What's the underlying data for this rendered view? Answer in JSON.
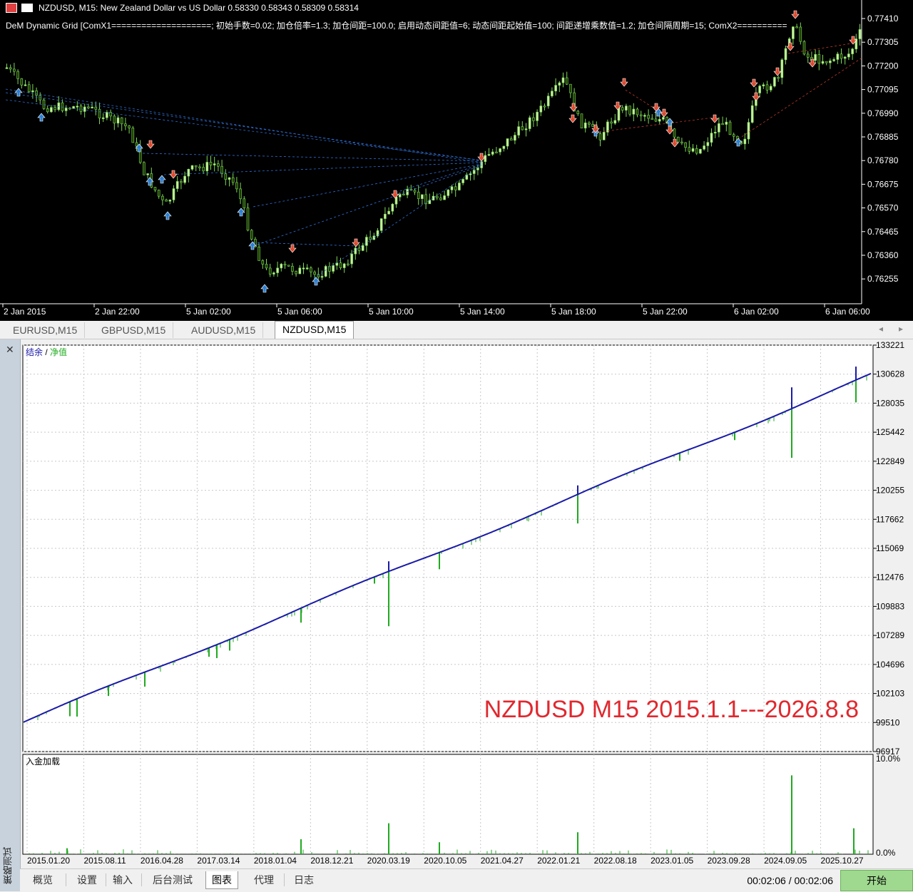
{
  "price_chart": {
    "symbol_line": "NZDUSD, M15:  New Zealand Dollar vs US Dollar  0.58330 0.58343 0.58309 0.58314",
    "indicator_line": "DeM Dynamic Grid [ComX1====================; 初始手数=0.02; 加仓倍率=1.3; 加仓间距=100.0; 启用动态间距值=6; 动态间距起始值=100; 间距递增乘数值=1.2; 加仓间隔周期=15; ComX2==========",
    "price_labels": [
      "0.77410",
      "0.77305",
      "0.77200",
      "0.77095",
      "0.76990",
      "0.76885",
      "0.76780",
      "0.76675",
      "0.76570",
      "0.76465",
      "0.76360",
      "0.76255"
    ],
    "time_labels": [
      "2 Jan 2015",
      "2 Jan 22:00",
      "5 Jan 02:00",
      "5 Jan 06:00",
      "5 Jan 10:00",
      "5 Jan 14:00",
      "5 Jan 18:00",
      "5 Jan 22:00",
      "6 Jan 02:00",
      "6 Jan 06:00"
    ],
    "colors": {
      "background": "#000000",
      "bull": "#c8f0a0",
      "bear": "#1a3a00",
      "wick": "#7ed957",
      "buy_arrow": "#2a7fd4",
      "sell_arrow": "#e0482c"
    }
  },
  "chart_tabs": {
    "items": [
      "EURUSD,M15",
      "GBPUSD,M15",
      "AUDUSD,M15",
      "NZDUSD,M15"
    ],
    "active": "NZDUSD,M15"
  },
  "tester": {
    "close_label": "✕",
    "side_label": "策略测试",
    "legend_balance": "结余",
    "legend_sep": " / ",
    "legend_equity": "净值",
    "watermark": "NZDUSD M15 2015.1.1---2026.8.8",
    "deposit_label": "入金加载",
    "deposit_max": "10.0%",
    "deposit_min": "0.0%",
    "y_labels": [
      "133221",
      "130628",
      "128035",
      "125442",
      "122849",
      "120255",
      "117662",
      "115069",
      "112476",
      "109883",
      "107289",
      "104696",
      "102103",
      "99510",
      "96917"
    ],
    "x_labels": [
      "2015.01.20",
      "2015.08.11",
      "2016.04.28",
      "2017.03.14",
      "2018.01.04",
      "2018.12.21",
      "2020.03.19",
      "2020.10.05",
      "2021.04.27",
      "2022.01.21",
      "2022.08.18",
      "2023.01.05",
      "2023.09.28",
      "2024.09.05",
      "2025.10.27"
    ],
    "colors": {
      "balance": "#1a1aa8",
      "equity": "#1faa1f",
      "watermark": "#e0282e",
      "grid": "#c8c8c8"
    }
  },
  "chart_data": {
    "type": "line",
    "title": "",
    "series": [
      {
        "name": "结余"
      },
      {
        "name": "净值"
      }
    ],
    "x": [
      "2015.01.20",
      "2015.08.11",
      "2016.04.28",
      "2017.03.14",
      "2018.01.04",
      "2018.12.21",
      "2020.03.19",
      "2020.10.05",
      "2021.04.27",
      "2022.01.21",
      "2022.08.18",
      "2023.01.05",
      "2023.09.28",
      "2024.09.05",
      "2025.10.27"
    ],
    "balance_start": 99510,
    "balance_end": 130628,
    "ylim": [
      96917,
      133221
    ]
  },
  "bottom_bar": {
    "tabs": [
      "概览",
      "设置",
      "输入",
      "后台测试",
      "图表",
      "代理",
      "日志"
    ],
    "active": "图表",
    "timer": "00:02:06 / 00:02:06",
    "start_label": "开始"
  }
}
